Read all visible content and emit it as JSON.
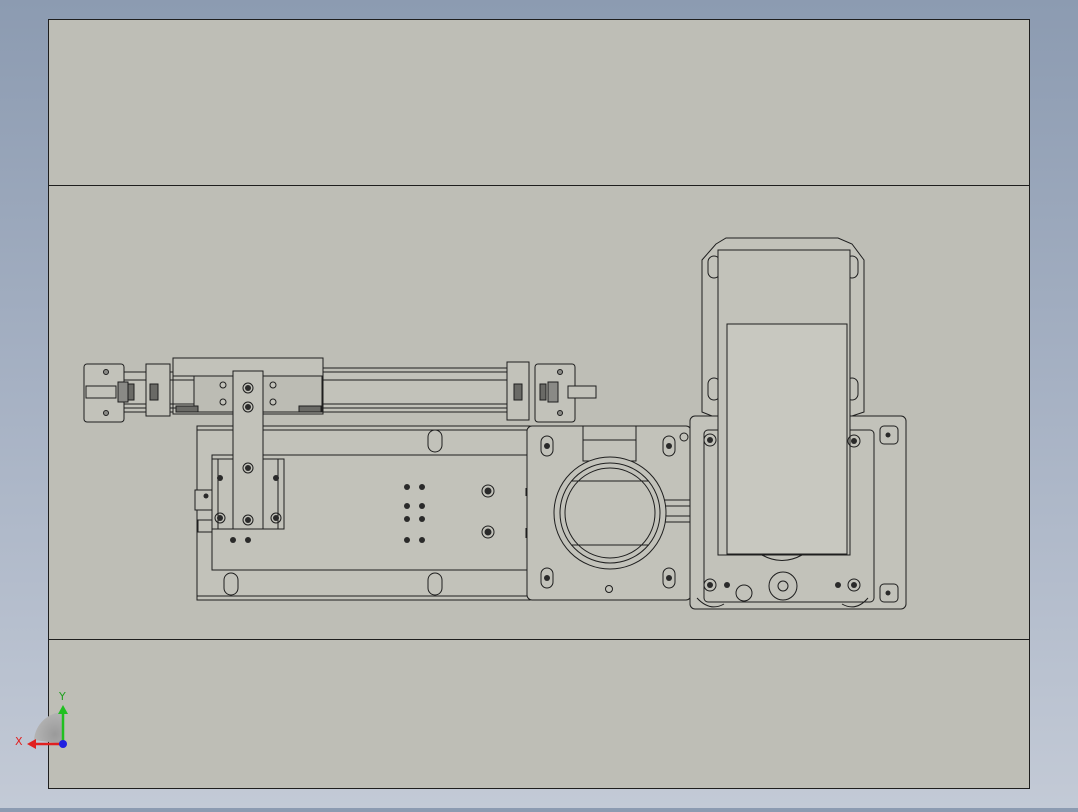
{
  "viewport": {
    "background_top": "#8c9bb1",
    "background_bottom": "#c3cad6",
    "sheet_fill": "#bebeb6",
    "line_color": "#1e1e1e",
    "part_fill": "#c2c2ba"
  },
  "triad": {
    "x_label": "X",
    "y_label": "Y",
    "x_color": "#e02020",
    "y_color": "#20c020",
    "z_color": "#2020e0"
  },
  "components": [
    "sheet-frame",
    "slide-cylinder-assembly",
    "base-plate",
    "slider-bracket",
    "valve-body",
    "motor-housing"
  ]
}
